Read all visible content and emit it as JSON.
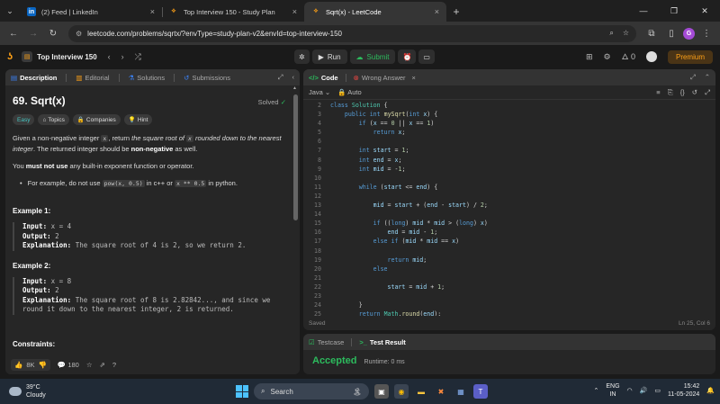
{
  "browser": {
    "tabs": [
      {
        "favicon": "in",
        "title": "(2) Feed | LinkedIn",
        "favicon_color": "#0a66c2"
      },
      {
        "favicon": "lc",
        "title": "Top Interview 150 - Study Plan",
        "favicon_color": "#ffa116"
      },
      {
        "favicon": "lc",
        "title": "Sqrt(x) - LeetCode",
        "favicon_color": "#ffa116"
      }
    ],
    "url": "leetcode.com/problems/sqrtx/?envType=study-plan-v2&envId=top-interview-150",
    "profile_initial": "G"
  },
  "lc_nav": {
    "plan_title": "Top Interview 150",
    "run_label": "Run",
    "submit_label": "Submit",
    "streak": "0",
    "premium_label": "Premium"
  },
  "left": {
    "tabs": [
      "Description",
      "Editorial",
      "Solutions",
      "Submissions"
    ],
    "title": "69. Sqrt(x)",
    "status": "Solved",
    "chips": [
      "Easy",
      "Topics",
      "Companies",
      "Hint"
    ],
    "desc1_a": "Given a non-negative integer ",
    "desc1_code": "x",
    "desc1_b": ", return ",
    "desc1_i1": "the square root of ",
    "desc1_code2": "x",
    "desc1_i2": " rounded down to the nearest integer",
    "desc1_c": ". The returned integer should be ",
    "desc1_bold": "non-negative",
    "desc1_d": " as well.",
    "desc2_a": "You ",
    "desc2_bold": "must not use",
    "desc2_b": " any built-in exponent function or operator.",
    "bullet_a": "For example, do not use ",
    "bullet_code1": "pow(x, 0.5)",
    "bullet_b": " in c++ or ",
    "bullet_code2": "x ** 0.5",
    "bullet_c": " in python.",
    "examples": [
      {
        "title": "Example 1:",
        "input_label": "Input:",
        "input": " x = 4",
        "output_label": "Output:",
        "output": " 2",
        "expl_label": "Explanation:",
        "expl": " The square root of 4 is 2, so we return 2.",
        "expl2": ""
      },
      {
        "title": "Example 2:",
        "input_label": "Input:",
        "input": " x = 8",
        "output_label": "Output:",
        "output": " 2",
        "expl_label": "Explanation:",
        "expl": " The square root of 8 is 2.82842..., and since we",
        "expl2": "round it down to the nearest integer, 2 is returned."
      }
    ],
    "constraints_title": "Constraints:",
    "likes": "8K",
    "comments": "180"
  },
  "code": {
    "tab_code": "Code",
    "tab_wrong": "Wrong Answer",
    "language": "Java",
    "mode": "Auto",
    "status_left": "Saved",
    "status_right": "Ln 25, Col 6",
    "current_line": 25
  },
  "test": {
    "tab_testcase": "Testcase",
    "tab_result": "Test Result",
    "result": "Accepted",
    "runtime": "Runtime: 0 ms"
  },
  "taskbar": {
    "temp": "39°C",
    "weather": "Cloudy",
    "search": "Search",
    "lang1": "ENG",
    "lang2": "IN",
    "time": "15:42",
    "date": "11-05-2024"
  }
}
